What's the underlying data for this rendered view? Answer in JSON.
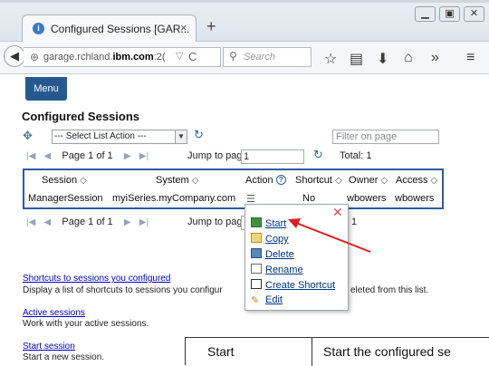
{
  "browser": {
    "tab_title": "Configured Sessions [GAR...",
    "tab_close": "×",
    "new_tab": "+",
    "url_prefix": "garage.rchland.",
    "url_domain": "ibm.com",
    "url_suffix": ":2(",
    "search_placeholder": "Search",
    "window_controls": [
      "minimize-icon",
      "maximize-icon",
      "close-icon"
    ],
    "toolbar_icons": [
      "star-icon",
      "reading-list-icon",
      "download-icon",
      "home-icon",
      "overflow-icon",
      "hamburger-menu-icon"
    ]
  },
  "page": {
    "menu_label": "Menu",
    "title": "Configured Sessions",
    "list_action": "--- Select List Action ---",
    "filter_placeholder": "Filter on page",
    "pagination_top": {
      "page_text": "Page 1 of 1",
      "jump_label": "Jump to page:",
      "jump_value": "1",
      "total": "Total: 1"
    },
    "pagination_bottom": {
      "page_text": "Page 1 of 1",
      "jump_label": "Jump to page:",
      "jump_value": "1",
      "total_tail": "1"
    }
  },
  "table": {
    "headers": [
      "Session",
      "System",
      "Action",
      "Shortcut",
      "Owner",
      "Access"
    ],
    "rows": [
      {
        "session": "ManagerSession",
        "system": "myiSeries.myCompany.com",
        "action": "",
        "shortcut": "No",
        "owner": "wbowers",
        "access": "wbowers"
      }
    ]
  },
  "context_menu": {
    "items": [
      {
        "label": "Start",
        "icon": "start-icon"
      },
      {
        "label": "Copy",
        "icon": "copy-icon"
      },
      {
        "label": "Delete",
        "icon": "trash-icon"
      },
      {
        "label": "Rename",
        "icon": "rename-icon"
      },
      {
        "label": "Create Shortcut",
        "icon": "shortcut-icon"
      },
      {
        "label": "Edit",
        "icon": "edit-icon"
      }
    ]
  },
  "links": [
    {
      "title": "Shortcuts to sessions you configured",
      "desc_left": "Display a list of shortcuts to sessions you configur",
      "desc_right": "eleted from this list."
    },
    {
      "title": "Active sessions",
      "desc": "Work with your active sessions."
    },
    {
      "title": "Start session",
      "desc": "Start a new session."
    }
  ],
  "legend": {
    "col1": "Start",
    "col2": "Start the configured se"
  },
  "colors": {
    "menu_bg": "#25598f",
    "table_border": "#2c5aa0",
    "link": "#0000cc",
    "annotation_arrow": "#e02020"
  }
}
